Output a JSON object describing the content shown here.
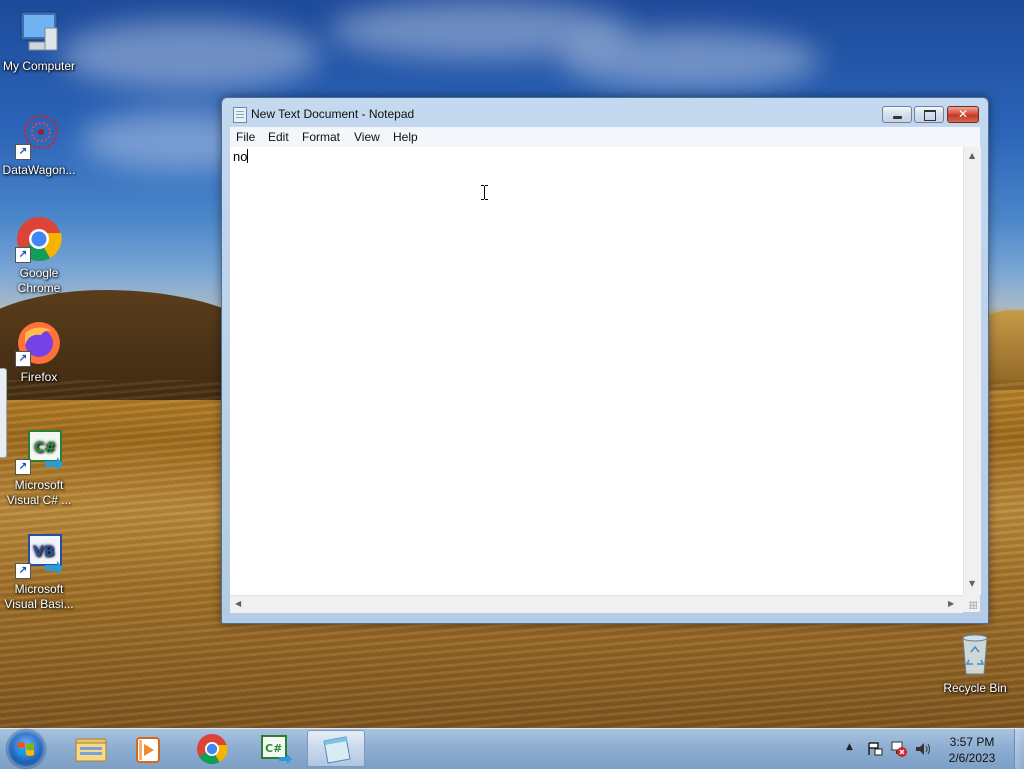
{
  "desktop": {
    "icons": [
      {
        "label_line1": "My Computer",
        "label_line2": ""
      },
      {
        "label_line1": "DataWagon...",
        "label_line2": ""
      },
      {
        "label_line1": "Google",
        "label_line2": "Chrome"
      },
      {
        "label_line1": "Firefox",
        "label_line2": ""
      },
      {
        "label_line1": "Microsoft",
        "label_line2": "Visual C# ..."
      },
      {
        "label_line1": "Microsoft",
        "label_line2": "Visual Basi..."
      },
      {
        "label_line1": "Recycle Bin",
        "label_line2": ""
      }
    ],
    "csharp_glyph": "C#",
    "vb_glyph": "VB"
  },
  "notepad": {
    "title": "New Text Document - Notepad",
    "menu": [
      "File",
      "Edit",
      "Format",
      "View",
      "Help"
    ],
    "content": "no"
  },
  "taskbar": {
    "pinned": [
      "windows-explorer",
      "media-player",
      "google-chrome",
      "visual-csharp",
      "notepad"
    ],
    "csharp_glyph": "C#",
    "clock_time": "3:57 PM",
    "clock_date": "2/6/2023"
  },
  "colors": {
    "accent": "#1e63b8",
    "close_button": "#c13a24"
  }
}
